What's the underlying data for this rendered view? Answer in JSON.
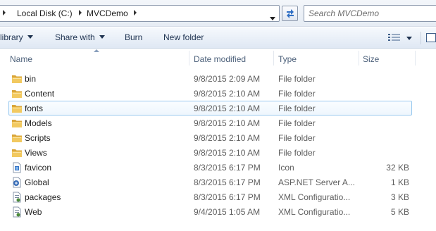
{
  "address": {
    "crumbs": [
      "Local Disk (C:)",
      "MVCDemo"
    ]
  },
  "search": {
    "placeholder": "Search MVCDemo"
  },
  "toolbar": {
    "library_label": "library",
    "share_label": "Share with",
    "burn_label": "Burn",
    "newfolder_label": "New folder"
  },
  "columns": {
    "name": "Name",
    "date": "Date modified",
    "type": "Type",
    "size": "Size"
  },
  "files": [
    {
      "name": "bin",
      "date": "9/8/2015 2:09 AM",
      "type": "File folder",
      "size": "",
      "icon": "folder-icon"
    },
    {
      "name": "Content",
      "date": "9/8/2015 2:10 AM",
      "type": "File folder",
      "size": "",
      "icon": "folder-icon"
    },
    {
      "name": "fonts",
      "date": "9/8/2015 2:10 AM",
      "type": "File folder",
      "size": "",
      "icon": "folder-icon",
      "selected": true
    },
    {
      "name": "Models",
      "date": "9/8/2015 2:10 AM",
      "type": "File folder",
      "size": "",
      "icon": "folder-icon"
    },
    {
      "name": "Scripts",
      "date": "9/8/2015 2:10 AM",
      "type": "File folder",
      "size": "",
      "icon": "folder-icon"
    },
    {
      "name": "Views",
      "date": "9/8/2015 2:10 AM",
      "type": "File folder",
      "size": "",
      "icon": "folder-icon"
    },
    {
      "name": "favicon",
      "date": "8/3/2015 6:17 PM",
      "type": "Icon",
      "size": "32 KB",
      "icon": "favicon-icon"
    },
    {
      "name": "Global",
      "date": "8/3/2015 6:17 PM",
      "type": "ASP.NET Server A...",
      "size": "1 KB",
      "icon": "aspnet-file-icon"
    },
    {
      "name": "packages",
      "date": "8/3/2015 6:17 PM",
      "type": "XML Configuratio...",
      "size": "3 KB",
      "icon": "config-file-icon"
    },
    {
      "name": "Web",
      "date": "9/4/2015 1:05 AM",
      "type": "XML Configuratio...",
      "size": "5 KB",
      "icon": "config-file-icon"
    }
  ],
  "colors": {
    "selection_border": "#99c9ef",
    "folder": "#e8b94a",
    "header_text": "#4c607a"
  }
}
